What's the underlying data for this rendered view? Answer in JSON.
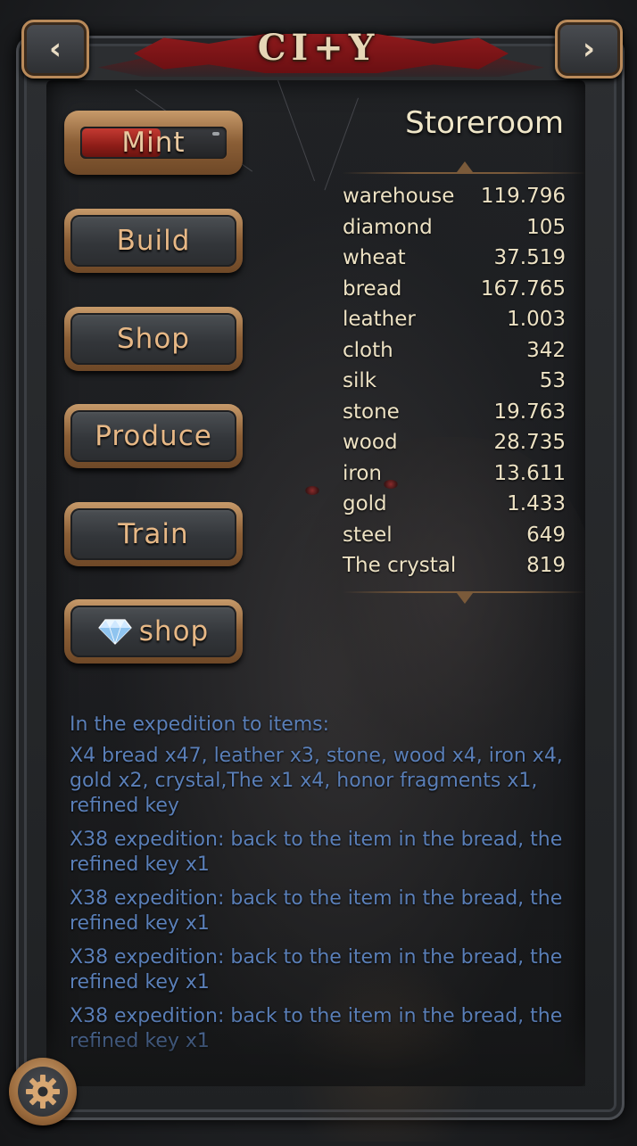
{
  "header": {
    "title": "CI+Y",
    "back_icon": "‹",
    "forward_icon": "›"
  },
  "actions": [
    {
      "label": "Mint",
      "progress_percent": 55
    },
    {
      "label": "Build"
    },
    {
      "label": "Shop"
    },
    {
      "label": "Produce"
    },
    {
      "label": "Train"
    },
    {
      "label": "shop",
      "icon": "diamond-icon"
    }
  ],
  "storeroom": {
    "title": "Storeroom",
    "items": [
      {
        "name": "warehouse",
        "value": "119.796"
      },
      {
        "name": "diamond",
        "value": "105"
      },
      {
        "name": "wheat",
        "value": "37.519"
      },
      {
        "name": "bread",
        "value": "167.765"
      },
      {
        "name": "leather",
        "value": "1.003"
      },
      {
        "name": "cloth",
        "value": "342"
      },
      {
        "name": "silk",
        "value": "53"
      },
      {
        "name": "stone",
        "value": "19.763"
      },
      {
        "name": "wood",
        "value": "28.735"
      },
      {
        "name": "iron",
        "value": "13.611"
      },
      {
        "name": "gold",
        "value": "1.433"
      },
      {
        "name": "steel",
        "value": "649"
      },
      {
        "name": "The crystal",
        "value": "819"
      }
    ]
  },
  "log": {
    "heading": "In the expedition to items:",
    "entries": [
      "X4 bread x47, leather x3, stone, wood x4, iron x4, gold x2, crystal,The x1 x4, honor fragments x1, refined key",
      "X38 expedition: back to the item in the bread, the refined key x1",
      "X38 expedition: back to the item in the bread, the refined key x1",
      "X38 expedition: back to the item in the bread, the refined key x1",
      "X38 expedition: back to the item in the bread, the refined key x1"
    ]
  },
  "colors": {
    "accent": "#e7b886",
    "log_text": "#5a7fb8",
    "banner": "#8e1a1c"
  },
  "settings_icon": "gear-icon"
}
